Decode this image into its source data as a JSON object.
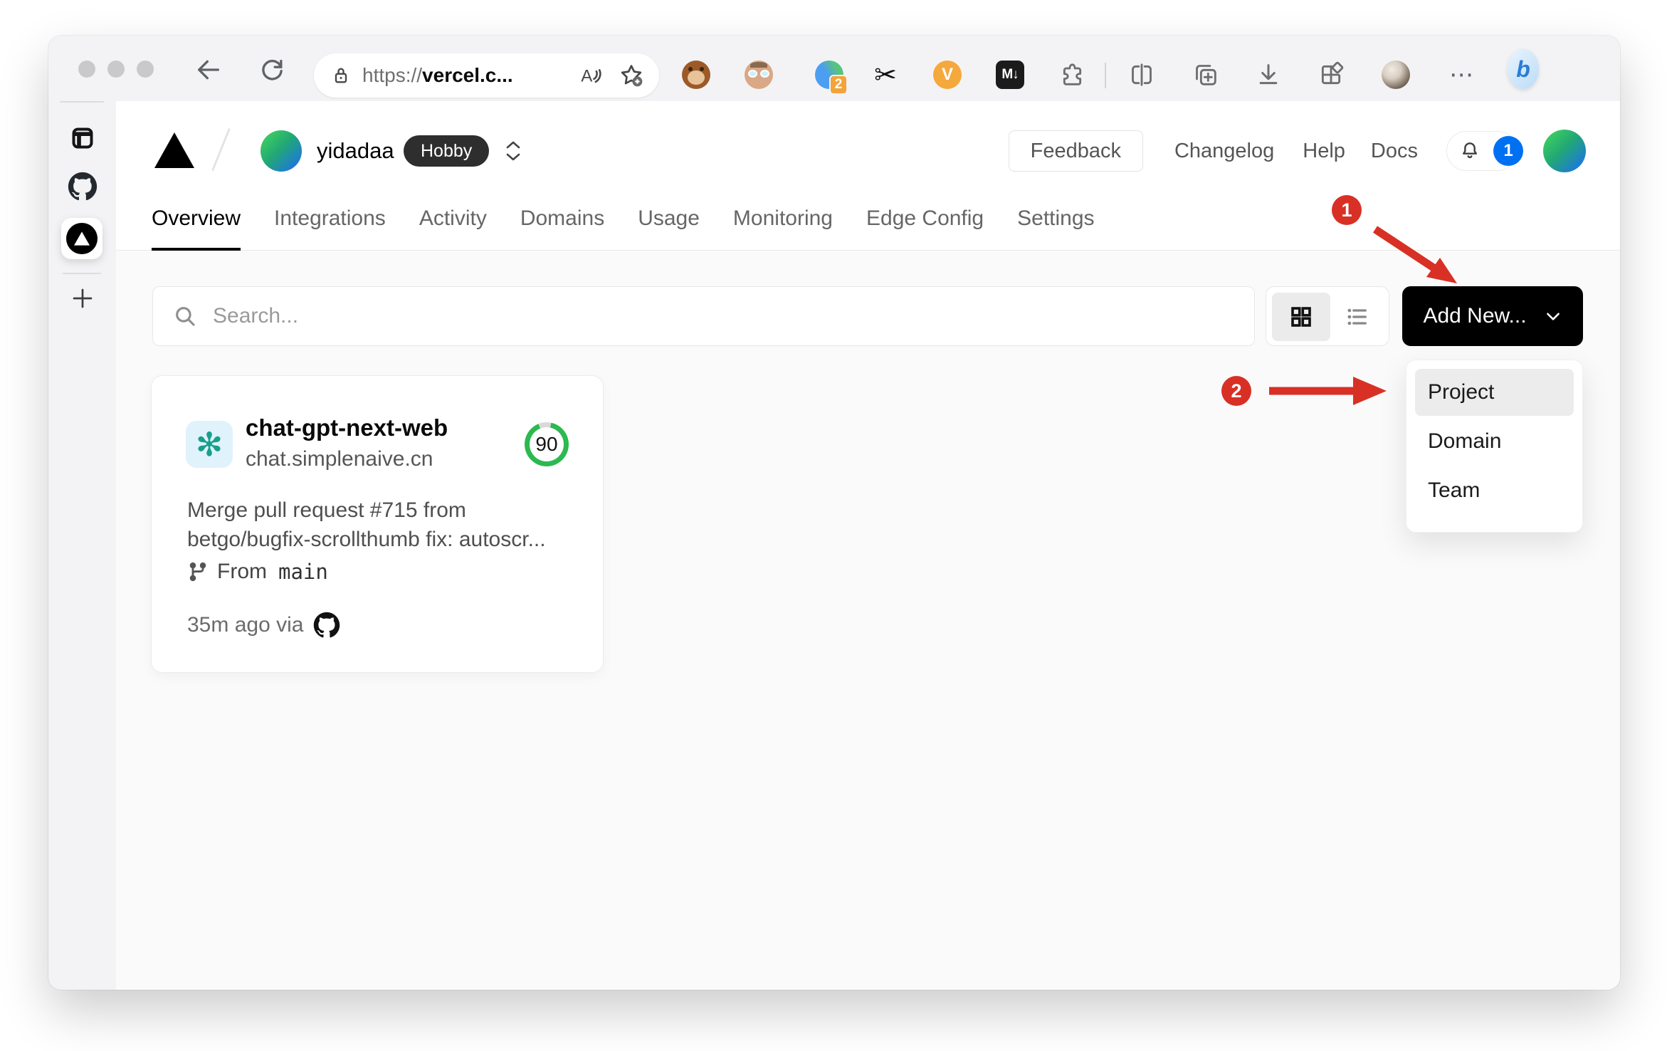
{
  "browser": {
    "address_bar": {
      "scheme": "https://",
      "host": "vercel.c..."
    },
    "extensions": {
      "translate_badge": "2",
      "v_label": "V",
      "m_label": "M↓",
      "bing_label": "b",
      "more_label": "⋯"
    }
  },
  "vercel": {
    "team": {
      "name": "yidadaa",
      "plan": "Hobby"
    },
    "header_links": {
      "feedback": "Feedback",
      "changelog": "Changelog",
      "help": "Help",
      "docs": "Docs"
    },
    "notification_count": "1",
    "tabs": [
      {
        "label": "Overview",
        "active": true
      },
      {
        "label": "Integrations",
        "active": false
      },
      {
        "label": "Activity",
        "active": false
      },
      {
        "label": "Domains",
        "active": false
      },
      {
        "label": "Usage",
        "active": false
      },
      {
        "label": "Monitoring",
        "active": false
      },
      {
        "label": "Edge Config",
        "active": false
      },
      {
        "label": "Settings",
        "active": false
      }
    ],
    "search": {
      "placeholder": "Search..."
    },
    "add_new": {
      "label": "Add New..."
    },
    "dropdown": {
      "items": [
        {
          "label": "Project",
          "highlighted": true
        },
        {
          "label": "Domain",
          "highlighted": false
        },
        {
          "label": "Team",
          "highlighted": false
        }
      ]
    },
    "project": {
      "name": "chat-gpt-next-web",
      "domain": "chat.simplenaive.cn",
      "score": "90",
      "commit": {
        "line1": "Merge pull request #715 from",
        "line2": "betgo/bugfix-scrollthumb fix: autoscr..."
      },
      "branch": {
        "prefix": "From",
        "name": "main"
      },
      "deployed": "35m ago via"
    }
  },
  "annotations": {
    "step1": "1",
    "step2": "2"
  },
  "colors": {
    "annotation_red": "#d93025",
    "notification_blue": "#0070f3",
    "score_ring_green": "#2cb94f",
    "plan_pill_bg": "#2e2e2e",
    "avatar_gradient": [
      "#3ecf62",
      "#1c6ff0"
    ],
    "openai_teal": "#17a08b",
    "openai_tile_bg": "#e0f2fb",
    "add_new_bg": "#000000",
    "page_bg": "#fafafa"
  }
}
